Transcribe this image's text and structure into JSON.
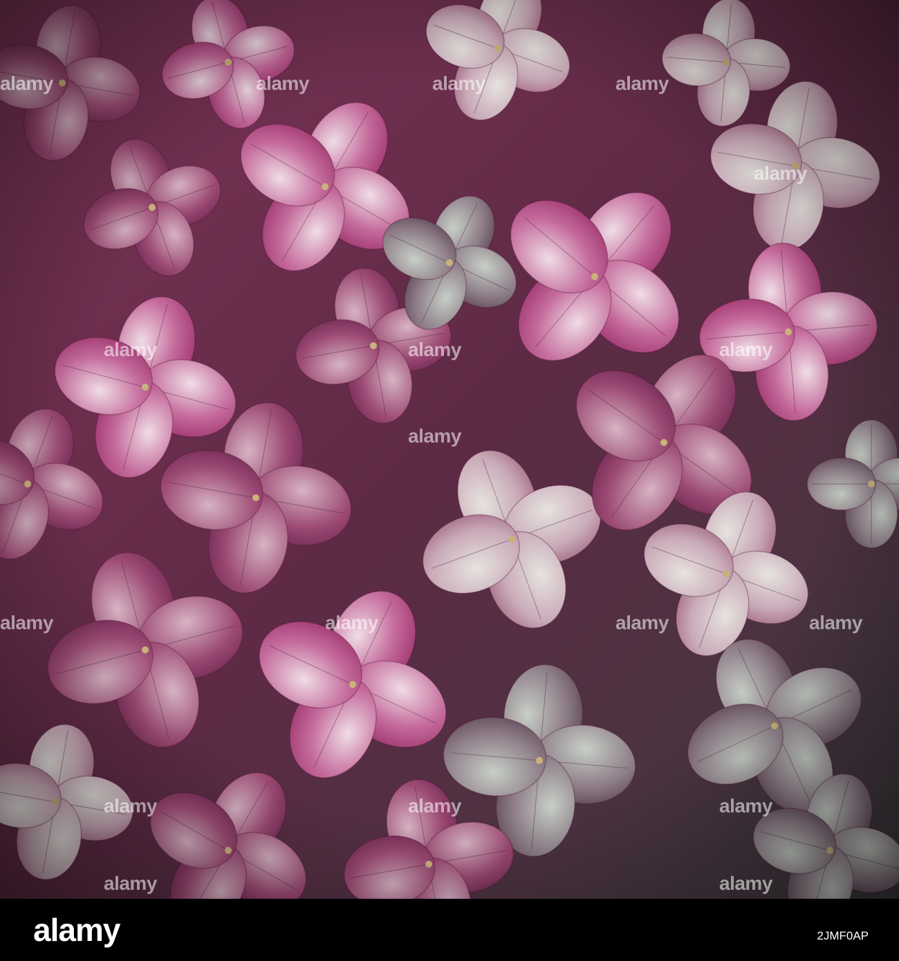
{
  "photo": {
    "subject": "dried hydrangea florets",
    "palette": [
      "#b0487e",
      "#8c3a63",
      "#c98fb0",
      "#d9c6cc",
      "#5e2a45",
      "#a7b7ae"
    ],
    "watermark_text": "alamy"
  },
  "footer": {
    "logo": "alamy",
    "image_id": "2JMF0AP"
  }
}
